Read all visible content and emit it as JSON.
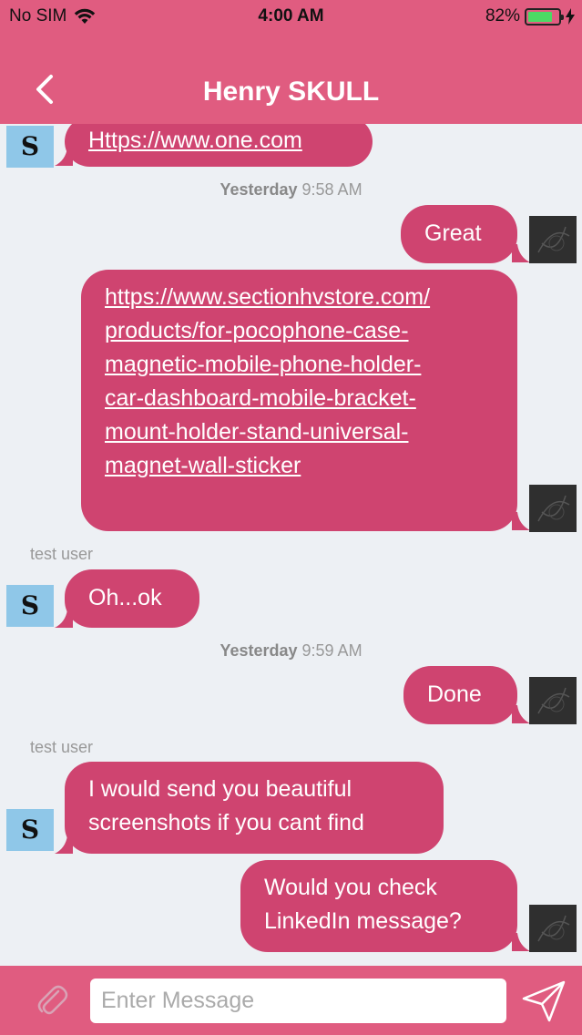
{
  "status_bar": {
    "carrier": "No SIM",
    "time": "4:00 AM",
    "battery": "82%",
    "battery_level": 0.82
  },
  "header": {
    "title": "Henry SKULL"
  },
  "avatar": {
    "contact_letter": "S"
  },
  "messages": [
    {
      "direction": "in",
      "text": "Https://www.one.com",
      "is_link": true
    },
    {
      "type": "timestamp",
      "day": "Yesterday",
      "time": "9:58 AM"
    },
    {
      "direction": "out",
      "text": "Great"
    },
    {
      "direction": "out",
      "text": "https://www.sectionhvstore.com/products/for-pocophone-case-magnetic-mobile-phone-holder-car-dashboard-mobile-bracket-mount-holder-stand-universal-magnet-wall-sticker",
      "lines": [
        "https://www.sectionhvstore.com/",
        "products/for-pocophone-case-",
        "magnetic-mobile-phone-holder-",
        "car-dashboard-mobile-bracket-",
        "mount-holder-stand-universal-",
        "magnet-wall-sticker"
      ],
      "is_link": true
    },
    {
      "type": "sender",
      "name": "test user"
    },
    {
      "direction": "in",
      "text": "Oh...ok"
    },
    {
      "type": "timestamp",
      "day": "Yesterday",
      "time": "9:59 AM"
    },
    {
      "direction": "out",
      "text": "Done"
    },
    {
      "type": "sender",
      "name": "test user"
    },
    {
      "direction": "in",
      "lines": [
        "I would send you beautiful",
        "screenshots if you cant find"
      ]
    },
    {
      "direction": "out",
      "lines": [
        "Would you check",
        "LinkedIn message?"
      ]
    }
  ],
  "input": {
    "placeholder": "Enter Message",
    "value": ""
  },
  "colors": {
    "bar": "#e05c80",
    "bubble": "#cf4470",
    "background": "#edf0f4"
  },
  "icons": [
    "back-chevron-icon",
    "wifi-icon",
    "battery-icon",
    "charging-bolt-icon",
    "paperclip-icon",
    "send-icon"
  ]
}
